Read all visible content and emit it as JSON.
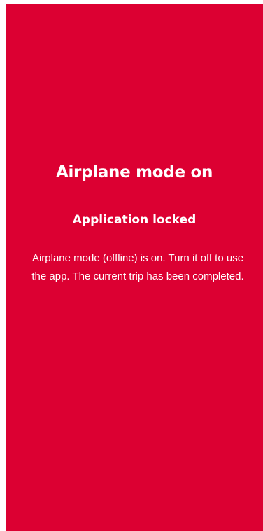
{
  "lock_screen": {
    "title": "Airplane mode on",
    "subtitle": "Application locked",
    "message": "Airplane mode (offline) is on. Turn it off to use the app. The current trip has been completed.",
    "background_color": "#dc0032",
    "text_color": "#ffffff"
  }
}
